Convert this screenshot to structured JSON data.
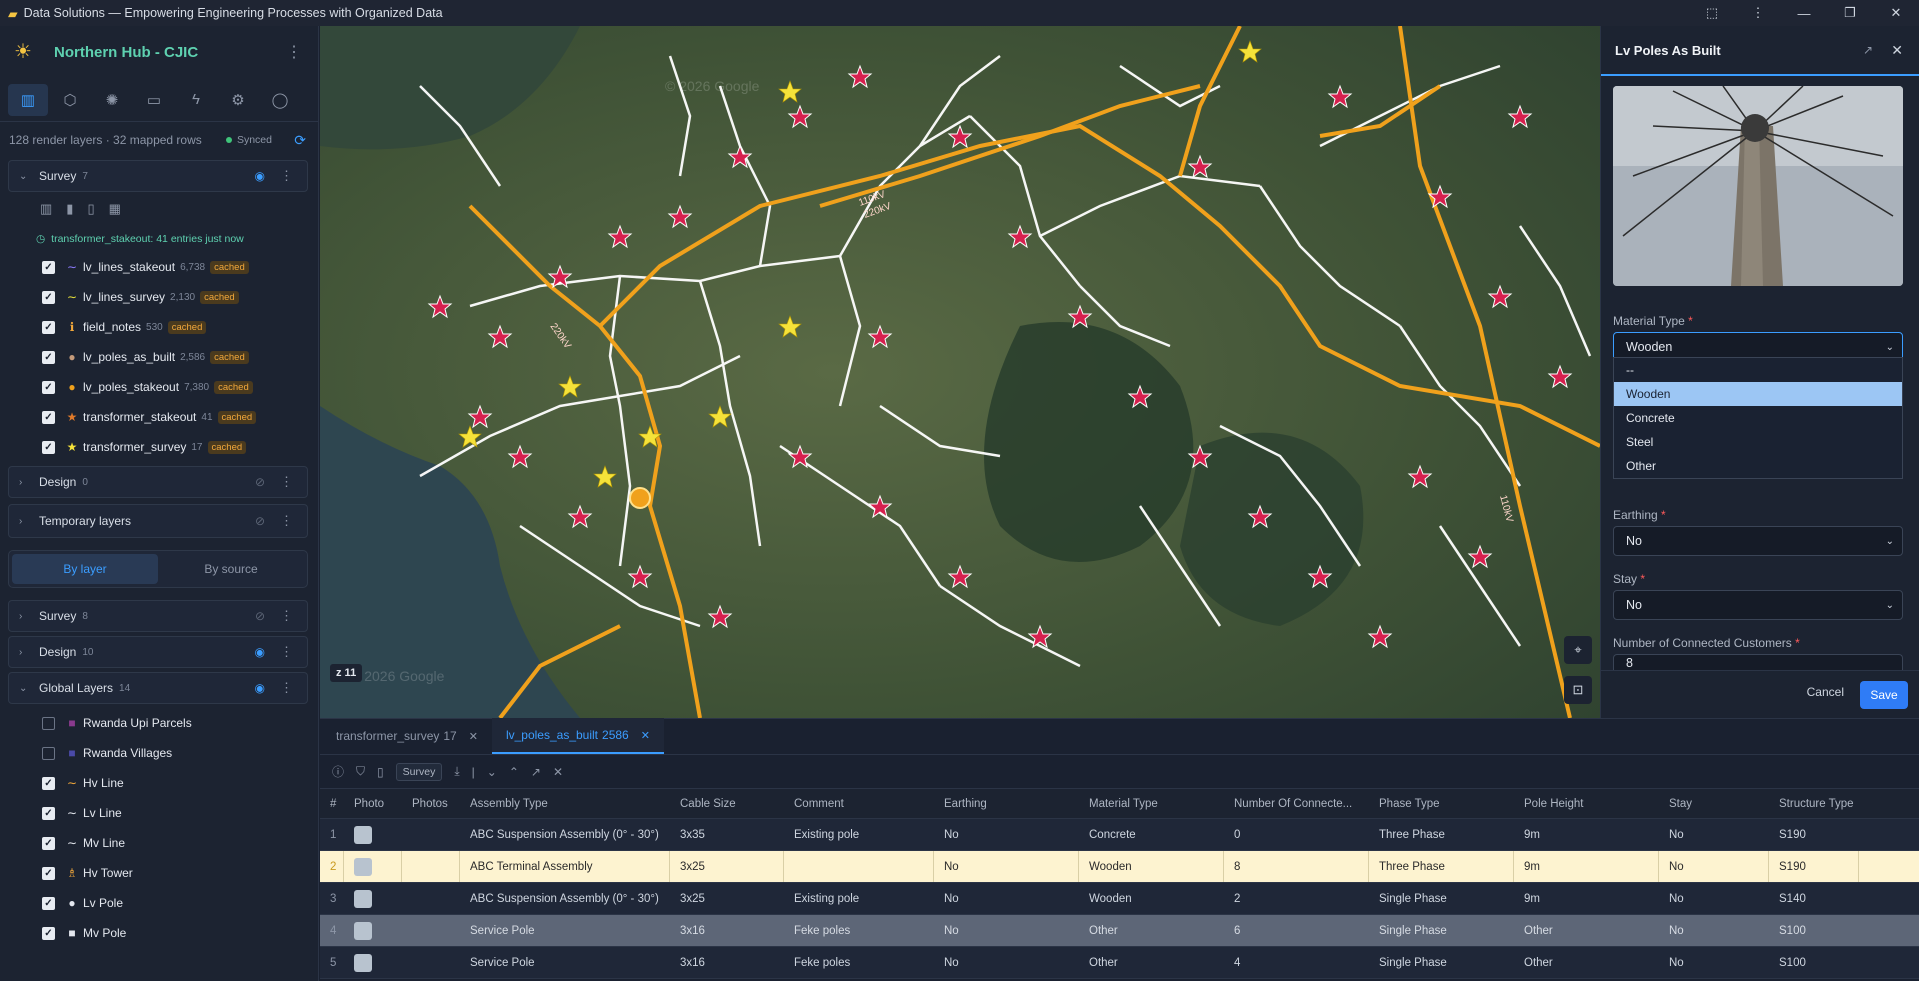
{
  "window": {
    "title": "Data Solutions — Empowering Engineering Processes with Organized Data"
  },
  "workspace": {
    "name": "Northern Hub - CJIC"
  },
  "nav": {
    "icons": [
      "map-icon",
      "cube-icon",
      "sun-icon",
      "folder-icon",
      "bolt-icon",
      "gear-icon",
      "user-icon"
    ]
  },
  "status": {
    "summary": "128 render layers · 32 mapped rows",
    "synced": "Synced"
  },
  "survey_group": {
    "name": "Survey",
    "count": "7",
    "entries": "transformer_stakeout: 41 entries just now",
    "layers": [
      {
        "name": "lv_lines_stakeout",
        "count": "6,738",
        "badge": "cached",
        "color": "#8e7cff"
      },
      {
        "name": "lv_lines_survey",
        "count": "2,130",
        "badge": "cached",
        "color": "#e8e23a"
      },
      {
        "name": "field_notes",
        "count": "530",
        "badge": "cached",
        "color": "#f2a83b"
      },
      {
        "name": "lv_poles_as_built",
        "count": "2,586",
        "badge": "cached",
        "color": "#c49a7a"
      },
      {
        "name": "lv_poles_stakeout",
        "count": "7,380",
        "badge": "cached",
        "color": "#f0a11c"
      },
      {
        "name": "transformer_stakeout",
        "count": "41",
        "badge": "cached",
        "color": "#e07a2a"
      },
      {
        "name": "transformer_survey",
        "count": "17",
        "badge": "cached",
        "color": "#f5e23a"
      }
    ]
  },
  "design_group": {
    "name": "Design",
    "count": "0"
  },
  "temp_group": {
    "name": "Temporary layers"
  },
  "segment": {
    "by_layer": "By layer",
    "by_source": "By source"
  },
  "survey_src": {
    "name": "Survey",
    "count": "8"
  },
  "design_src": {
    "name": "Design",
    "count": "10"
  },
  "global_group": {
    "name": "Global Layers",
    "count": "14",
    "layers": [
      {
        "name": "Rwanda Upi Parcels",
        "checked": false,
        "color": "#8a3a8e"
      },
      {
        "name": "Rwanda Villages",
        "checked": false,
        "color": "#4a4aa8"
      },
      {
        "name": "Hv Line",
        "checked": true,
        "color": "#f2a83b"
      },
      {
        "name": "Lv Line",
        "checked": true,
        "color": "#e4e8ef"
      },
      {
        "name": "Mv Line",
        "checked": true,
        "color": "#e4e8ef"
      },
      {
        "name": "Hv Tower",
        "checked": true,
        "color": "#f2a83b"
      },
      {
        "name": "Lv Pole",
        "checked": true,
        "color": "#e4e8ef"
      },
      {
        "name": "Mv Pole",
        "checked": true,
        "color": "#e4e8ef"
      }
    ]
  },
  "map": {
    "zoom": "z 11",
    "labels": [
      "220kV",
      "110kV",
      "220kV",
      "110kV"
    ],
    "watermark": "© 2026 Google"
  },
  "panel": {
    "title": "Lv Poles As Built",
    "material_label": "Material Type",
    "material_value": "Wooden",
    "material_options": [
      "--",
      "Wooden",
      "Concrete",
      "Steel",
      "Other"
    ],
    "earthing_label": "Earthing",
    "earthing_value": "No",
    "stay_label": "Stay",
    "stay_value": "No",
    "customers_label": "Number of Connected Customers",
    "customers_value": "8",
    "cancel": "Cancel",
    "save": "Save"
  },
  "bottom_tabs": [
    {
      "label": "transformer_survey",
      "count": "17"
    },
    {
      "label": "lv_poles_as_built",
      "count": "2586"
    }
  ],
  "toolbar": {
    "filter": "Survey"
  },
  "table": {
    "headers": [
      "#",
      "Photo",
      "Photos",
      "Assembly Type",
      "Cable Size",
      "Comment",
      "Earthing",
      "Material Type",
      "Number Of Connecte...",
      "Phase Type",
      "Pole Height",
      "Stay",
      "Structure Type"
    ],
    "rows": [
      [
        "1",
        "",
        "",
        "ABC Suspension Assembly (0° - 30°)",
        "3x35",
        "Existing pole",
        "No",
        "Concrete",
        "0",
        "Three Phase",
        "9m",
        "No",
        "S190"
      ],
      [
        "2",
        "",
        "",
        "ABC Terminal Assembly",
        "3x25",
        "",
        "No",
        "Wooden",
        "8",
        "Three Phase",
        "9m",
        "No",
        "S190"
      ],
      [
        "3",
        "",
        "",
        "ABC Suspension Assembly (0° - 30°)",
        "3x25",
        "Existing pole",
        "No",
        "Wooden",
        "2",
        "Single Phase",
        "9m",
        "No",
        "S140"
      ],
      [
        "4",
        "",
        "",
        "Service Pole",
        "3x16",
        "Feke poles",
        "No",
        "Other",
        "6",
        "Single Phase",
        "Other",
        "No",
        "S100"
      ],
      [
        "5",
        "",
        "",
        "Service Pole",
        "3x16",
        "Feke poles",
        "No",
        "Other",
        "4",
        "Single Phase",
        "Other",
        "No",
        "S100"
      ]
    ]
  }
}
